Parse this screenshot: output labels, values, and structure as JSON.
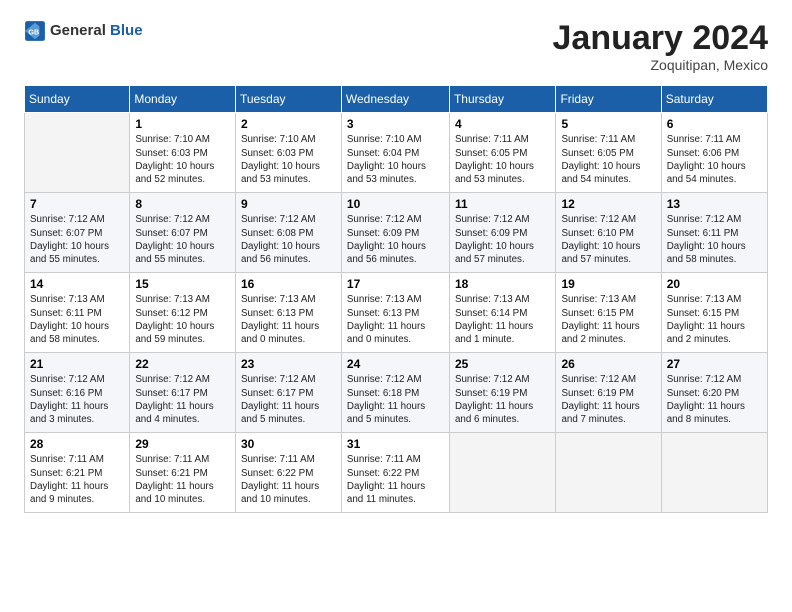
{
  "header": {
    "logo_general": "General",
    "logo_blue": "Blue",
    "month": "January 2024",
    "location": "Zoquitipan, Mexico"
  },
  "weekdays": [
    "Sunday",
    "Monday",
    "Tuesday",
    "Wednesday",
    "Thursday",
    "Friday",
    "Saturday"
  ],
  "weeks": [
    [
      {
        "num": "",
        "info": ""
      },
      {
        "num": "1",
        "info": "Sunrise: 7:10 AM\nSunset: 6:03 PM\nDaylight: 10 hours\nand 52 minutes."
      },
      {
        "num": "2",
        "info": "Sunrise: 7:10 AM\nSunset: 6:03 PM\nDaylight: 10 hours\nand 53 minutes."
      },
      {
        "num": "3",
        "info": "Sunrise: 7:10 AM\nSunset: 6:04 PM\nDaylight: 10 hours\nand 53 minutes."
      },
      {
        "num": "4",
        "info": "Sunrise: 7:11 AM\nSunset: 6:05 PM\nDaylight: 10 hours\nand 53 minutes."
      },
      {
        "num": "5",
        "info": "Sunrise: 7:11 AM\nSunset: 6:05 PM\nDaylight: 10 hours\nand 54 minutes."
      },
      {
        "num": "6",
        "info": "Sunrise: 7:11 AM\nSunset: 6:06 PM\nDaylight: 10 hours\nand 54 minutes."
      }
    ],
    [
      {
        "num": "7",
        "info": "Sunrise: 7:12 AM\nSunset: 6:07 PM\nDaylight: 10 hours\nand 55 minutes."
      },
      {
        "num": "8",
        "info": "Sunrise: 7:12 AM\nSunset: 6:07 PM\nDaylight: 10 hours\nand 55 minutes."
      },
      {
        "num": "9",
        "info": "Sunrise: 7:12 AM\nSunset: 6:08 PM\nDaylight: 10 hours\nand 56 minutes."
      },
      {
        "num": "10",
        "info": "Sunrise: 7:12 AM\nSunset: 6:09 PM\nDaylight: 10 hours\nand 56 minutes."
      },
      {
        "num": "11",
        "info": "Sunrise: 7:12 AM\nSunset: 6:09 PM\nDaylight: 10 hours\nand 57 minutes."
      },
      {
        "num": "12",
        "info": "Sunrise: 7:12 AM\nSunset: 6:10 PM\nDaylight: 10 hours\nand 57 minutes."
      },
      {
        "num": "13",
        "info": "Sunrise: 7:12 AM\nSunset: 6:11 PM\nDaylight: 10 hours\nand 58 minutes."
      }
    ],
    [
      {
        "num": "14",
        "info": "Sunrise: 7:13 AM\nSunset: 6:11 PM\nDaylight: 10 hours\nand 58 minutes."
      },
      {
        "num": "15",
        "info": "Sunrise: 7:13 AM\nSunset: 6:12 PM\nDaylight: 10 hours\nand 59 minutes."
      },
      {
        "num": "16",
        "info": "Sunrise: 7:13 AM\nSunset: 6:13 PM\nDaylight: 11 hours\nand 0 minutes."
      },
      {
        "num": "17",
        "info": "Sunrise: 7:13 AM\nSunset: 6:13 PM\nDaylight: 11 hours\nand 0 minutes."
      },
      {
        "num": "18",
        "info": "Sunrise: 7:13 AM\nSunset: 6:14 PM\nDaylight: 11 hours\nand 1 minute."
      },
      {
        "num": "19",
        "info": "Sunrise: 7:13 AM\nSunset: 6:15 PM\nDaylight: 11 hours\nand 2 minutes."
      },
      {
        "num": "20",
        "info": "Sunrise: 7:13 AM\nSunset: 6:15 PM\nDaylight: 11 hours\nand 2 minutes."
      }
    ],
    [
      {
        "num": "21",
        "info": "Sunrise: 7:12 AM\nSunset: 6:16 PM\nDaylight: 11 hours\nand 3 minutes."
      },
      {
        "num": "22",
        "info": "Sunrise: 7:12 AM\nSunset: 6:17 PM\nDaylight: 11 hours\nand 4 minutes."
      },
      {
        "num": "23",
        "info": "Sunrise: 7:12 AM\nSunset: 6:17 PM\nDaylight: 11 hours\nand 5 minutes."
      },
      {
        "num": "24",
        "info": "Sunrise: 7:12 AM\nSunset: 6:18 PM\nDaylight: 11 hours\nand 5 minutes."
      },
      {
        "num": "25",
        "info": "Sunrise: 7:12 AM\nSunset: 6:19 PM\nDaylight: 11 hours\nand 6 minutes."
      },
      {
        "num": "26",
        "info": "Sunrise: 7:12 AM\nSunset: 6:19 PM\nDaylight: 11 hours\nand 7 minutes."
      },
      {
        "num": "27",
        "info": "Sunrise: 7:12 AM\nSunset: 6:20 PM\nDaylight: 11 hours\nand 8 minutes."
      }
    ],
    [
      {
        "num": "28",
        "info": "Sunrise: 7:11 AM\nSunset: 6:21 PM\nDaylight: 11 hours\nand 9 minutes."
      },
      {
        "num": "29",
        "info": "Sunrise: 7:11 AM\nSunset: 6:21 PM\nDaylight: 11 hours\nand 10 minutes."
      },
      {
        "num": "30",
        "info": "Sunrise: 7:11 AM\nSunset: 6:22 PM\nDaylight: 11 hours\nand 10 minutes."
      },
      {
        "num": "31",
        "info": "Sunrise: 7:11 AM\nSunset: 6:22 PM\nDaylight: 11 hours\nand 11 minutes."
      },
      {
        "num": "",
        "info": ""
      },
      {
        "num": "",
        "info": ""
      },
      {
        "num": "",
        "info": ""
      }
    ]
  ]
}
